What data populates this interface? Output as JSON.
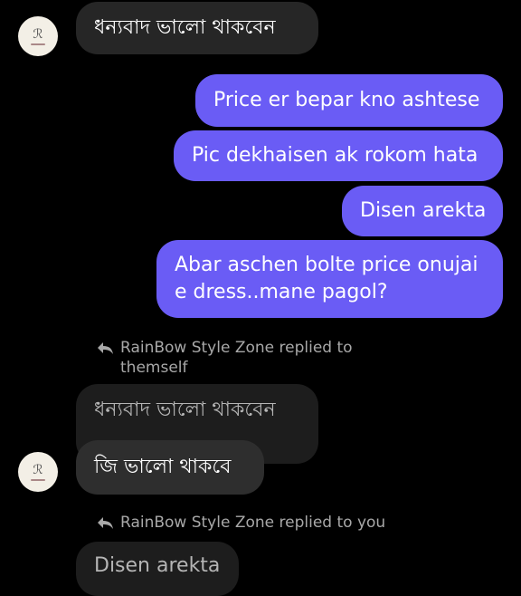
{
  "thread": {
    "messages": [
      {
        "text": "ধন্যবাদ ভালো থাকবেন"
      },
      {
        "text": "Price er bepar kno ashtese"
      },
      {
        "text": "Pic dekhaisen ak rokom hata"
      },
      {
        "text": "Disen arekta"
      },
      {
        "line1": "Abar aschen bolte price onujai",
        "line2": "e dress..mane pagol?"
      },
      {
        "quoted": "ধন্যবাদ ভালো থাকবেন",
        "text": "জি ভালো থাকবে"
      },
      {
        "quoted": "Disen arekta"
      }
    ],
    "reply_notes": [
      {
        "line1": "RainBow Style Zone  replied to",
        "line2": "themself"
      },
      {
        "line1": "RainBow Style Zone  replied to you"
      }
    ],
    "avatar_mark": "ℛ",
    "colors": {
      "outgoing": "#6a5cf5",
      "incoming": "#262626",
      "background": "#000000"
    }
  }
}
